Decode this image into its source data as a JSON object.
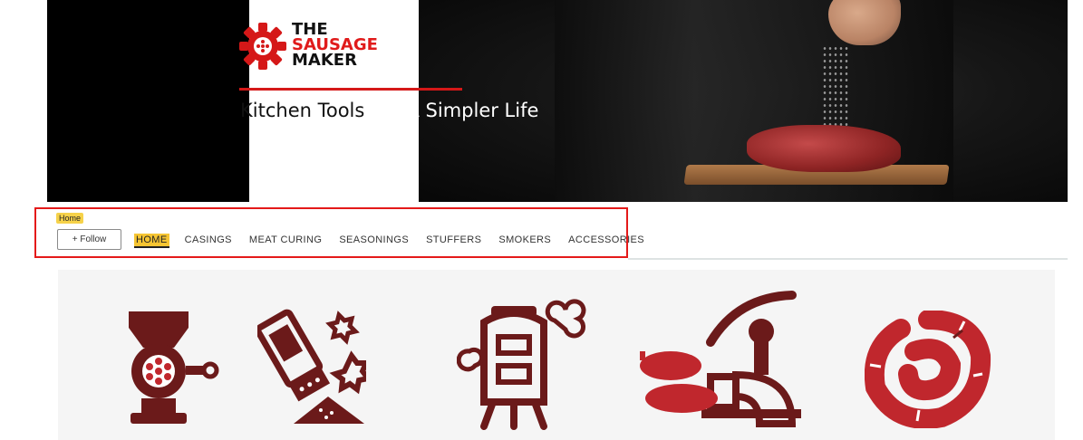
{
  "brand": {
    "logo_line1": "THE",
    "logo_line2": "SAUSAGE",
    "logo_line3": "MAKER",
    "tagline_part1": "Kitchen Tools ",
    "tagline_part2": "For A Simpler Life"
  },
  "colors": {
    "brand_red": "#d51818",
    "icon_maroon": "#6b1a1a",
    "icon_red": "#c0272d",
    "nav_highlight": "#f6c533"
  },
  "breadcrumb": "Home",
  "follow_label": "+ Follow",
  "nav": {
    "items": [
      {
        "label": "HOME",
        "active": true
      },
      {
        "label": "CASINGS",
        "active": false
      },
      {
        "label": "MEAT CURING",
        "active": false
      },
      {
        "label": "SEASONINGS",
        "active": false
      },
      {
        "label": "STUFFERS",
        "active": false
      },
      {
        "label": "SMOKERS",
        "active": false
      },
      {
        "label": "ACCESSORIES",
        "active": false
      }
    ]
  },
  "category_icons": [
    {
      "icon": "meat-grinder-icon"
    },
    {
      "icon": "seasoning-shaker-icon"
    },
    {
      "icon": "smoker-icon"
    },
    {
      "icon": "sausage-stuffer-icon"
    },
    {
      "icon": "sausage-links-icon"
    }
  ]
}
